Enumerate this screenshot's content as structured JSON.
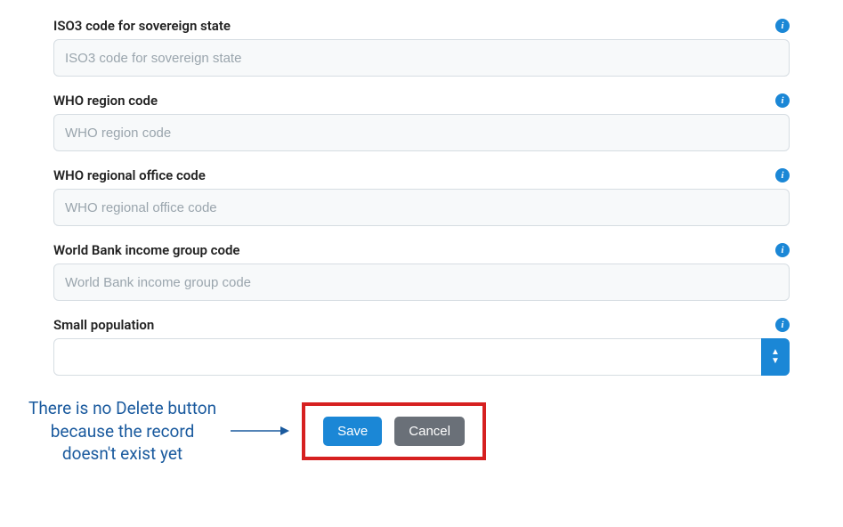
{
  "fields": {
    "iso3": {
      "label": "ISO3 code for sovereign state",
      "placeholder": "ISO3 code for sovereign state"
    },
    "whoRegion": {
      "label": "WHO region code",
      "placeholder": "WHO region code"
    },
    "whoOffice": {
      "label": "WHO regional office code",
      "placeholder": "WHO regional office code"
    },
    "wbIncome": {
      "label": "World Bank income group code",
      "placeholder": "World Bank income group code"
    },
    "smallPop": {
      "label": "Small population",
      "value": ""
    }
  },
  "annotation": {
    "line1": "There is no Delete button",
    "line2": "because the record",
    "line3": "doesn't exist yet"
  },
  "buttons": {
    "save": "Save",
    "cancel": "Cancel"
  },
  "colors": {
    "primary": "#1b87d6",
    "secondary": "#6a7078",
    "highlightBorder": "#d62020",
    "annotationText": "#1a5a9e"
  }
}
